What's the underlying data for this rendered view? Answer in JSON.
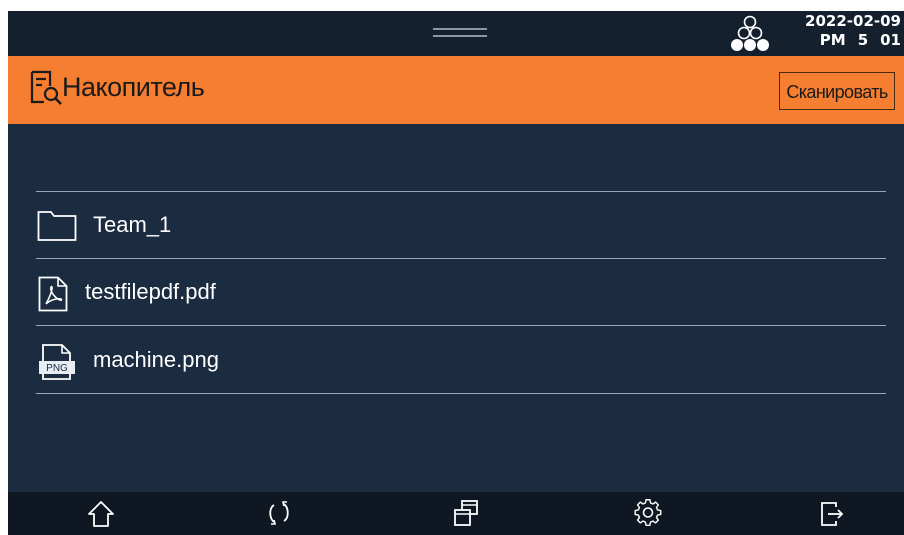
{
  "status": {
    "date": "2022-02-09",
    "ampm": "PM",
    "hour": "5",
    "minute": "01"
  },
  "header": {
    "title": "Накопитель",
    "scan_button": "Сканировать"
  },
  "files": [
    {
      "name": "Team_1",
      "icon": "folder-icon"
    },
    {
      "name": "testfilepdf.pdf",
      "icon": "pdf-file-icon"
    },
    {
      "name": "machine.png",
      "icon": "png-file-icon",
      "icon_text": "PNG"
    }
  ],
  "nav": [
    "home-icon",
    "refresh-icon",
    "windows-icon",
    "settings-icon",
    "logout-icon"
  ],
  "colors": {
    "background": "#1b2b40",
    "header": "#f67e30",
    "statusbar": "#14202e",
    "navbar": "#0f1822"
  }
}
